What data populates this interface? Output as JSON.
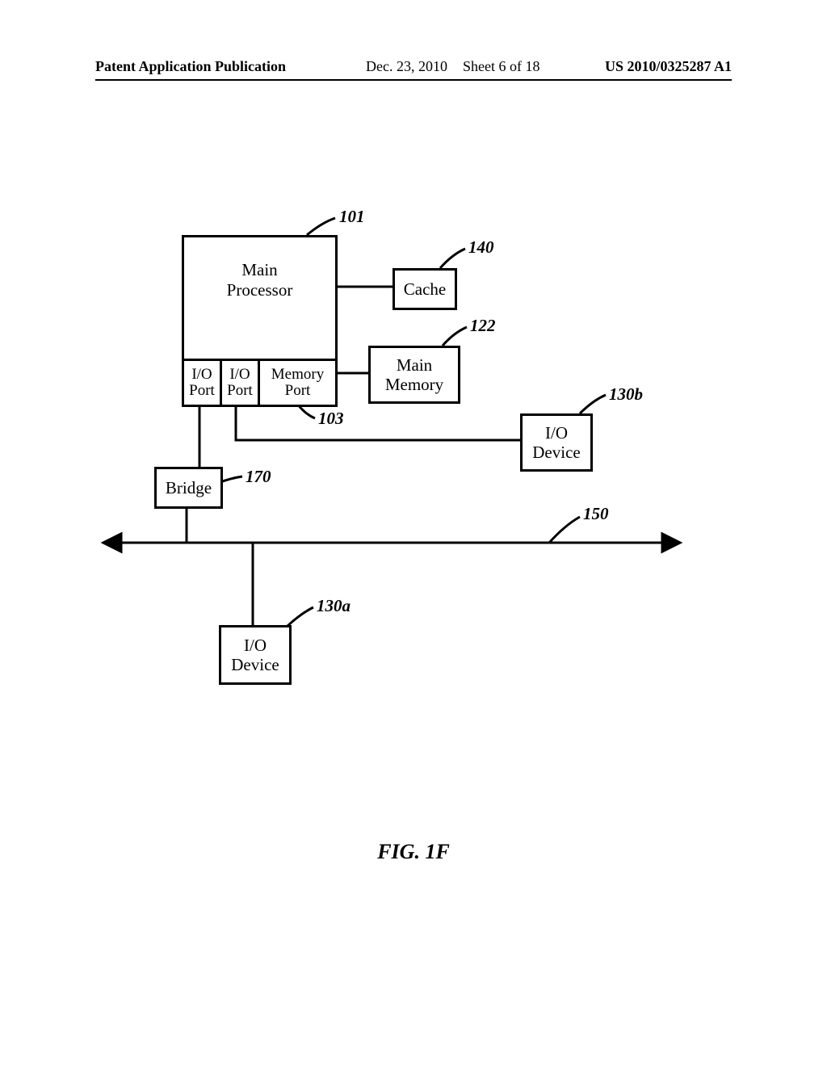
{
  "header": {
    "left": "Patent Application Publication",
    "date": "Dec. 23, 2010",
    "sheet": "Sheet 6 of 18",
    "pubno": "US 2010/0325287 A1"
  },
  "blocks": {
    "main_processor": "Main\nProcessor",
    "io_port": "I/O\nPort",
    "memory_port": "Memory\nPort",
    "cache": "Cache",
    "main_memory": "Main\nMemory",
    "io_device": "I/O\nDevice",
    "bridge": "Bridge"
  },
  "refs": {
    "r101": "101",
    "r140": "140",
    "r122": "122",
    "r103": "103",
    "r130b": "130b",
    "r170": "170",
    "r150": "150",
    "r130a": "130a"
  },
  "figure_caption": "FIG. 1F"
}
